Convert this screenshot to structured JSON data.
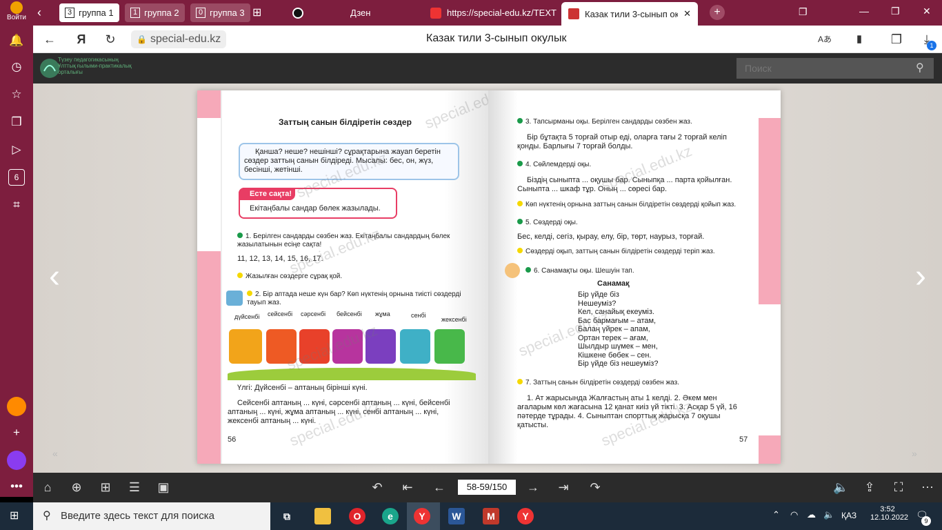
{
  "tabbar": {
    "groups": [
      {
        "num": "3",
        "label": "группа 1"
      },
      {
        "num": "1",
        "label": "группа 2"
      },
      {
        "num": "0",
        "label": "группа 3"
      }
    ],
    "tabs": [
      {
        "label": "Дзен"
      },
      {
        "label": "https://special-edu.kz/TEXT"
      },
      {
        "label": "Казак тили 3-сынып окулык"
      }
    ],
    "login_label": "Войти"
  },
  "address": {
    "url": "special-edu.kz",
    "title": "Казак тили 3-сынып окулык",
    "downloads_badge": "1"
  },
  "site": {
    "logo_text": [
      "Түзеу педагогикасының",
      "Ұлттық ғылыми-практикалық",
      "орталығы"
    ],
    "search_placeholder": "Поиск"
  },
  "left_page": {
    "heading": "Заттың санын білдіретін сөздер",
    "rule_box": "Қанша? неше? нешінші? сұрақтарына жауап беретін сөздер заттың санын білдіреді. Мысалы: бес, он, жүз, бесінші, жетінші.",
    "remember_label": "Есте сақта!",
    "remember_text": "Екітаңбалы сандар бөлек жазылады.",
    "task1": "1. Берілген сандарды сөзбен жаз. Екітаңбалы сандардың бөлек жазылатынын есіңе сақта!",
    "numbers": "11, 12, 13, 14, 15, 16, 17.",
    "task1b": "Жазылған сөздерге сұрақ қой.",
    "task2": "2. Бір аптада неше күн бар? Көп нүктенің орнына тиісті сөздерді тауып жаз.",
    "days": [
      "дүйсенбі",
      "сейсенбі",
      "сәрсенбі",
      "бейсенбі",
      "жұма",
      "сенбі",
      "жексенбі"
    ],
    "example": "Үлгі: Дүйсенбі – аптаның бірінші күні.",
    "exercise": "Сейсенбі аптаның ... күні, сәрсенбі аптаның ... күні, бейсенбі аптаның ... күні, жұма аптаның ... күні, сенбі аптаның ... күні, жексенбі аптаның ... күні.",
    "page_number": "56"
  },
  "right_page": {
    "task3": "3. Тапсырманы оқы. Берілген сандарды сөзбен жаз.",
    "text3": "Бір бұтақта 5 торғай отыр еді, оларға тағы 2 торғай келіп қонды. Барлығы 7 торғай болды.",
    "task4": "4. Сөйлемдерді оқы.",
    "text4": "Біздің сыныпта ... оқушы бар. Сыныпқа ... парта қойылған. Сыныпта ... шкаф тұр. Оның ... сөресі бар.",
    "task4b": "Көп нүктенің орнына заттың санын білдіретін сөздерді қойып жаз.",
    "task5": "5. Сөздерді оқы.",
    "text5": "Бес, келді, сегіз, қырау, елу, бір, төрт, наурыз, торғай.",
    "task5b": "Сөздерді оқып, заттың санын білдіретін сөздерді теріп жаз.",
    "task6": "6. Санамақты оқы. Шешуін тап.",
    "poem_title": "Санамақ",
    "poem": [
      "Бір үйде біз",
      "Нешеуміз?",
      "Кел, санайық екеуміз.",
      "Бас бармағым – атам,",
      "Балаң үйрек – апам,",
      "Ортан терек – ағам,",
      "Шылдыр шүмек – мен,",
      "Кішкене бөбек – сен.",
      "Бір үйде біз нешеуміз?"
    ],
    "task7": "7. Заттың санын білдіретін сөздерді сөзбен жаз.",
    "text7": "1. Ат жарысында Жалғастың аты 1 келді. 2. Әкем мен ағаларым көл жағасына 12 қанат киіз үй тікті. 3. Асқар 5 үй, 16 пәтерде тұрады. 4. Сыныптан спорттық жарысқа 7 оқушы қатысты.",
    "page_number": "57"
  },
  "watermark": "special.edu.kz",
  "viewer_toolbar": {
    "page_indicator": "58-59/150"
  },
  "taskbar": {
    "search_placeholder": "Введите здесь текст для поиска",
    "lang": "ҚАЗ",
    "time": "3:52",
    "date": "12.10.2022",
    "notif_count": "9"
  },
  "colors": {
    "browser_frame": "#7d1e3e",
    "accent_pink": "#f6a9b9",
    "green_dot": "#1a9a4a",
    "yellow_dot": "#f5d800"
  }
}
